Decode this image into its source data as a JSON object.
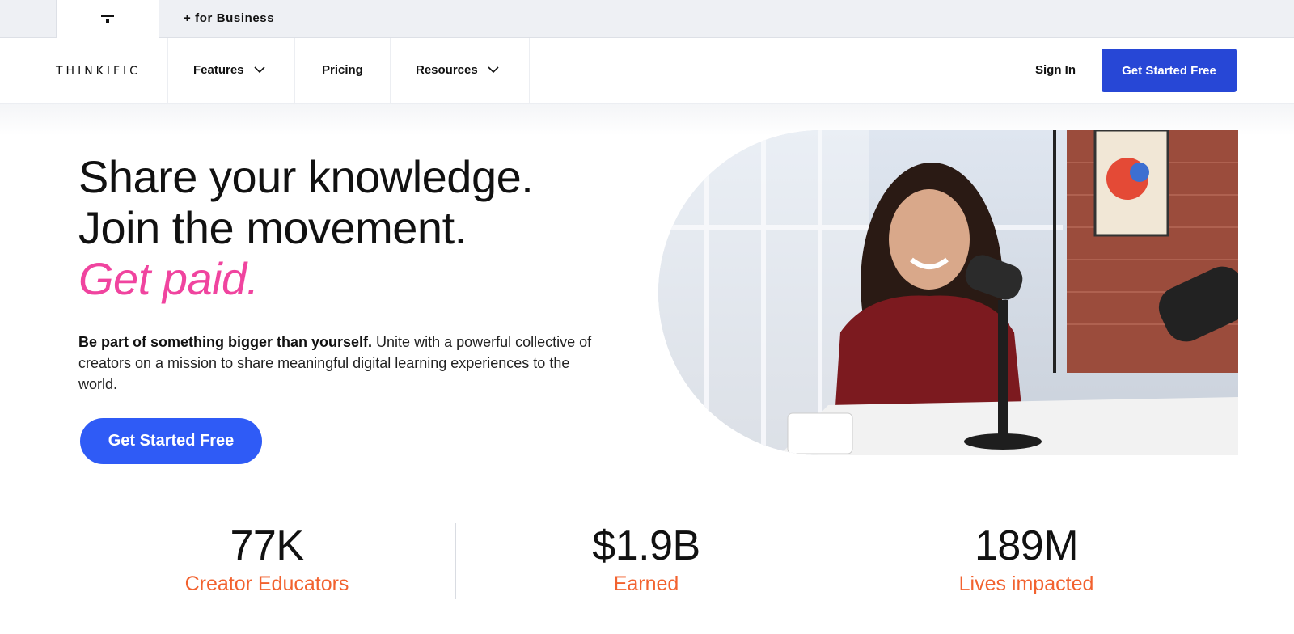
{
  "utility_bar": {
    "brand_icon": "thinkific-mark-icon",
    "business_link": "+ for Business"
  },
  "nav": {
    "logo": "THINKIFIC",
    "items": [
      {
        "label": "Features",
        "has_dropdown": true
      },
      {
        "label": "Pricing",
        "has_dropdown": false
      },
      {
        "label": "Resources",
        "has_dropdown": true
      }
    ],
    "sign_in": "Sign In",
    "cta": "Get Started Free"
  },
  "hero": {
    "line1": "Share your knowledge.",
    "line2": "Join the movement.",
    "line3": "Get paid.",
    "sub_bold": "Be part of something bigger than yourself.",
    "sub_rest": " Unite with a powerful collective of creators on a mission to share meaningful digital learning experiences to the world.",
    "cta": "Get Started Free",
    "image_alt": "woman-speaking-into-podcast-microphone"
  },
  "stats": [
    {
      "value": "77K",
      "label": "Creator Educators"
    },
    {
      "value": "$1.9B",
      "label": "Earned"
    },
    {
      "value": "189M",
      "label": "Lives impacted"
    }
  ],
  "colors": {
    "primary_blue": "#2747d6",
    "hero_button_blue": "#2f5bf6",
    "accent_pink": "#f0449f",
    "stat_orange": "#f2622f"
  }
}
